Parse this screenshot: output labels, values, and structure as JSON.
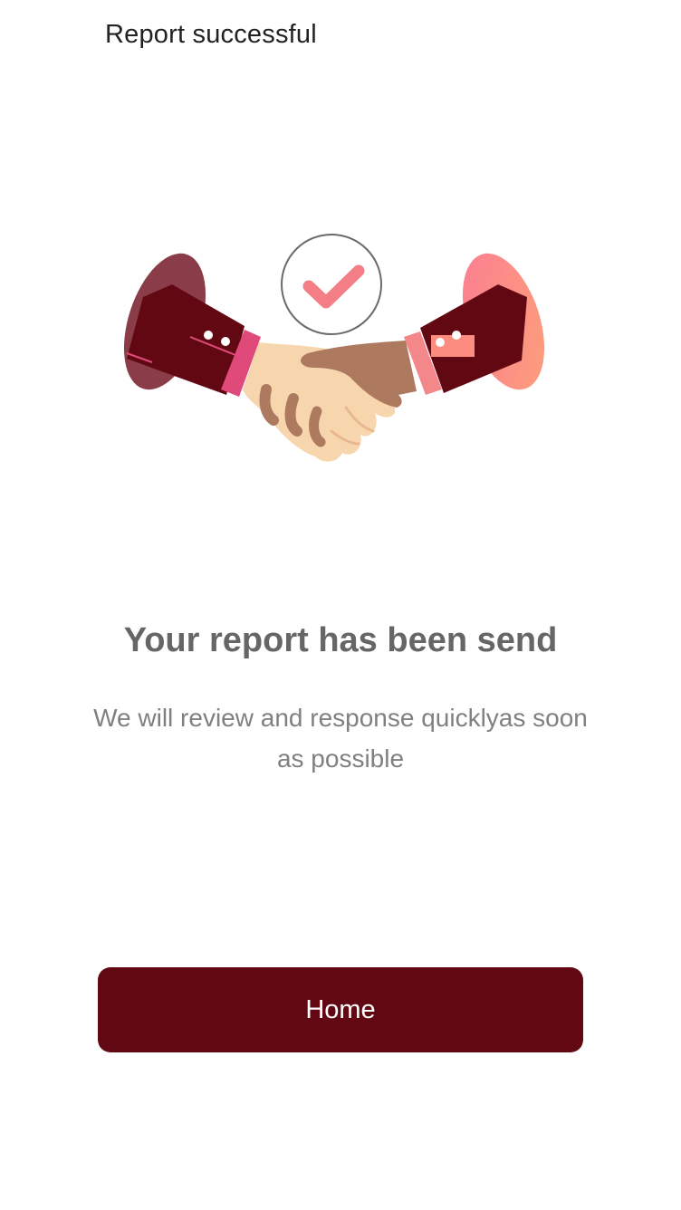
{
  "header": {
    "title": "Report successful"
  },
  "illustration": {
    "icon": "handshake-check-illustration",
    "colors": {
      "sleeve": "#620812",
      "cuff_left": "#e04a7a",
      "cuff_right": "#f4878a",
      "left_shadow": "#8a3d48",
      "right_shadow": "#fb8c8c",
      "skin_light": "#f7d5ad",
      "skin_dark": "#ad7a60",
      "check": "#f47e86"
    }
  },
  "main": {
    "heading": "Your report has been send",
    "message": "We will review and response quicklyas soon as possible"
  },
  "actions": {
    "home_label": "Home"
  },
  "colors": {
    "primary": "#620812",
    "heading_text": "#666666",
    "body_text": "#808080"
  }
}
